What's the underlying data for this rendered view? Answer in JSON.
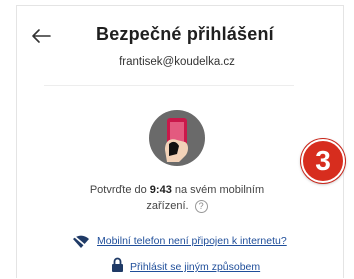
{
  "header": {
    "title": "Bezpečné přihlášení",
    "email": "frantisek@koudelka.cz"
  },
  "confirm": {
    "prefix": "Potvrďte do",
    "time": "9:43",
    "suffix": "na svém mobilním",
    "line2": "zařízení."
  },
  "badge": {
    "number": "3"
  },
  "links": {
    "no_internet": "Mobilní telefon není připojen k internetu?",
    "other_method": "Přihlásit se jiným způsobem"
  },
  "colors": {
    "accent_red": "#d72d1e",
    "link_blue": "#1f4e9a",
    "phone_pink": "#c9184a"
  },
  "icons": [
    "back-arrow-icon",
    "phone-approve-icon",
    "help-icon",
    "wifi-off-icon",
    "lock-icon"
  ]
}
